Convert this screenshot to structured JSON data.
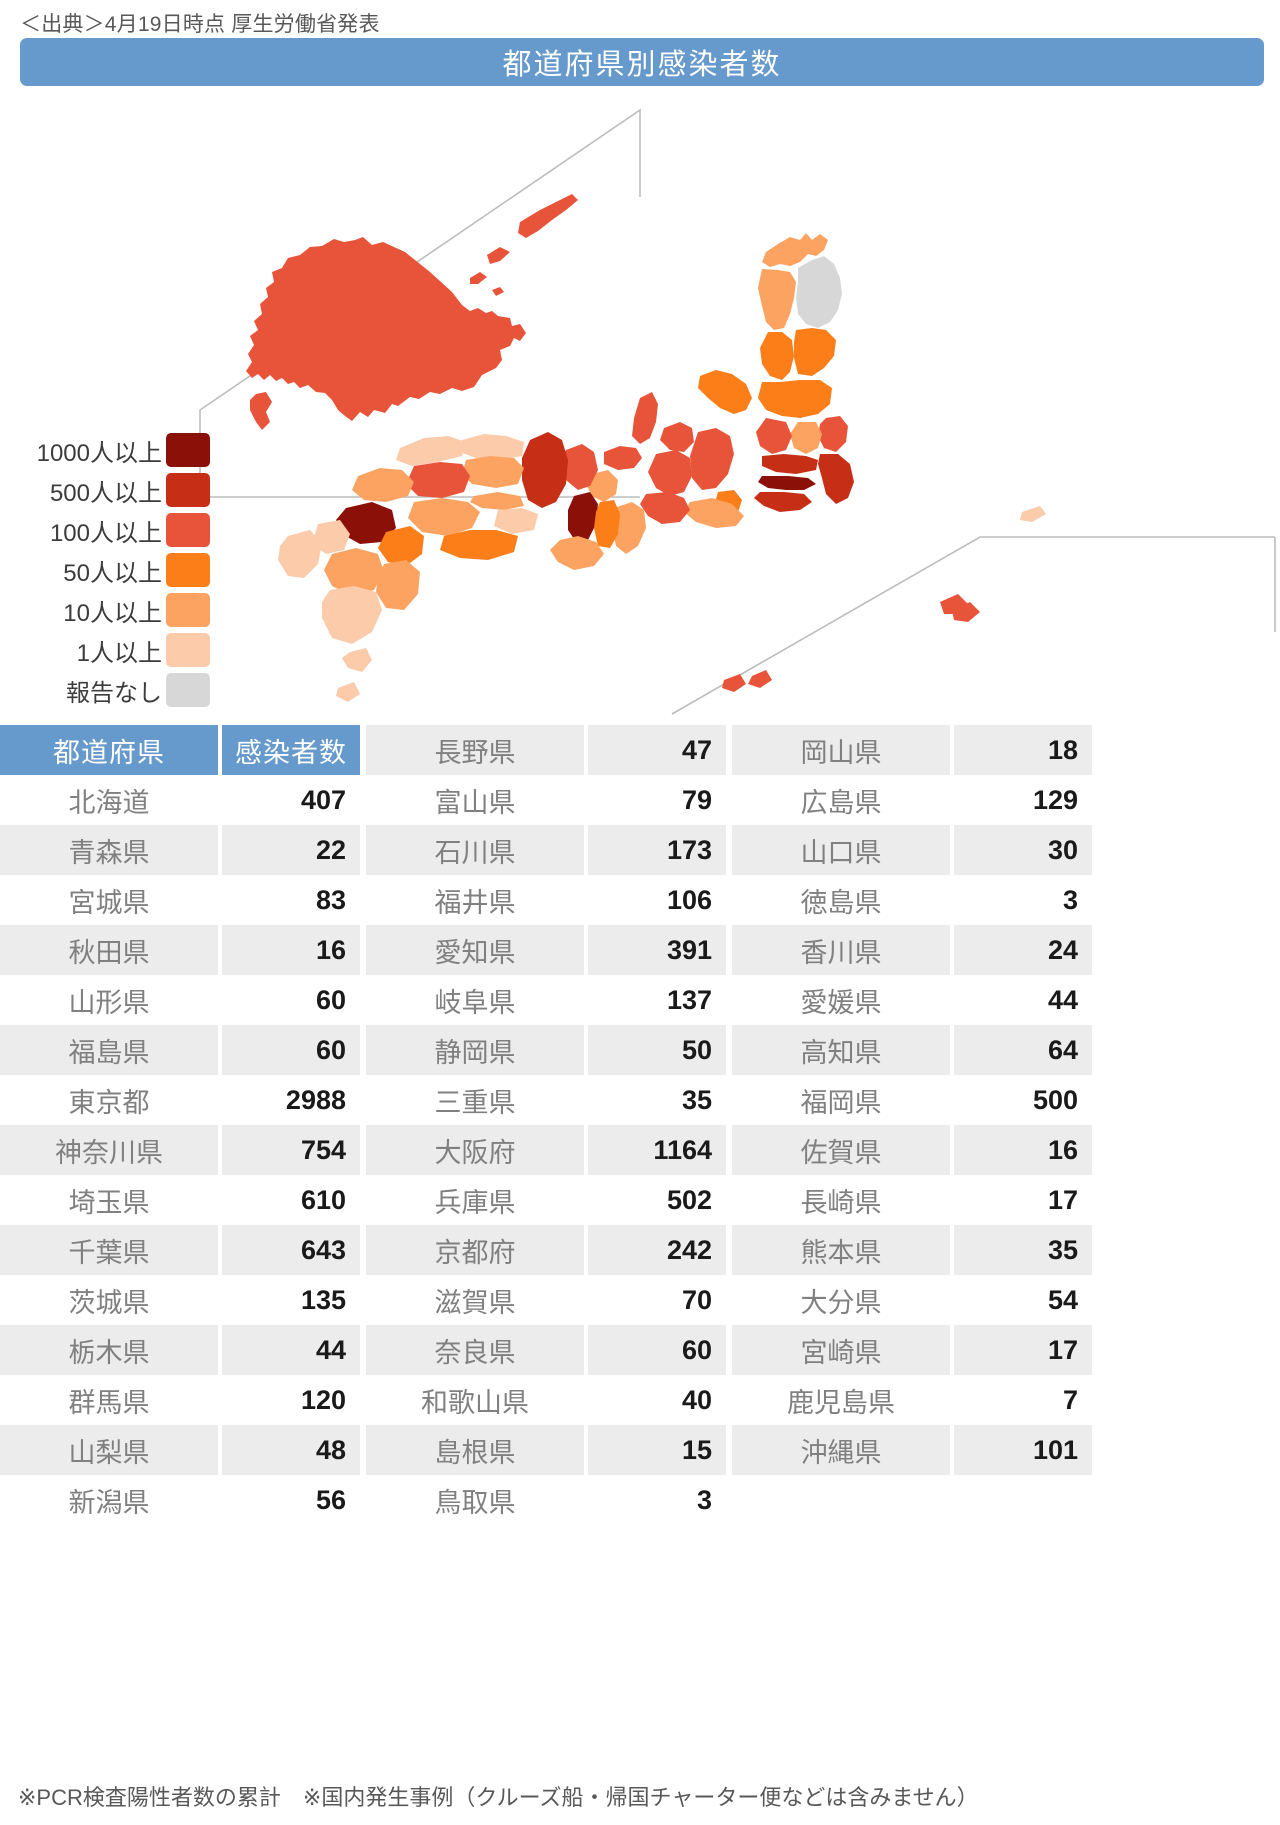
{
  "source": "＜出典＞4月19日時点 厚生労働省発表",
  "title": "都道府県別感染者数",
  "footnote": "※PCR検査陽性者数の累計　※国内発生事例（クルーズ船・帰国チャーター便などは含みません）",
  "legend": {
    "items": [
      {
        "label": "1000人以上",
        "color": "#8B1008"
      },
      {
        "label": "500人以上",
        "color": "#C62F16"
      },
      {
        "label": "100人以上",
        "color": "#E8543A"
      },
      {
        "label": "50人以上",
        "color": "#FB7E18"
      },
      {
        "label": "10人以上",
        "color": "#FCA361"
      },
      {
        "label": "1人以上",
        "color": "#FBCBAA"
      },
      {
        "label": "報告なし",
        "color": "#D7D7D7"
      }
    ]
  },
  "table": {
    "headers": {
      "prefecture": "都道府県",
      "count": "感染者数"
    },
    "columns": [
      [
        {
          "name": "北海道",
          "count": "407"
        },
        {
          "name": "青森県",
          "count": "22"
        },
        {
          "name": "宮城県",
          "count": "83"
        },
        {
          "name": "秋田県",
          "count": "16"
        },
        {
          "name": "山形県",
          "count": "60"
        },
        {
          "name": "福島県",
          "count": "60"
        },
        {
          "name": "東京都",
          "count": "2988"
        },
        {
          "name": "神奈川県",
          "count": "754"
        },
        {
          "name": "埼玉県",
          "count": "610"
        },
        {
          "name": "千葉県",
          "count": "643"
        },
        {
          "name": "茨城県",
          "count": "135"
        },
        {
          "name": "栃木県",
          "count": "44"
        },
        {
          "name": "群馬県",
          "count": "120"
        },
        {
          "name": "山梨県",
          "count": "48"
        },
        {
          "name": "新潟県",
          "count": "56"
        }
      ],
      [
        {
          "name": "長野県",
          "count": "47"
        },
        {
          "name": "富山県",
          "count": "79"
        },
        {
          "name": "石川県",
          "count": "173"
        },
        {
          "name": "福井県",
          "count": "106"
        },
        {
          "name": "愛知県",
          "count": "391"
        },
        {
          "name": "岐阜県",
          "count": "137"
        },
        {
          "name": "静岡県",
          "count": "50"
        },
        {
          "name": "三重県",
          "count": "35"
        },
        {
          "name": "大阪府",
          "count": "1164"
        },
        {
          "name": "兵庫県",
          "count": "502"
        },
        {
          "name": "京都府",
          "count": "242"
        },
        {
          "name": "滋賀県",
          "count": "70"
        },
        {
          "name": "奈良県",
          "count": "60"
        },
        {
          "name": "和歌山県",
          "count": "40"
        },
        {
          "name": "島根県",
          "count": "15"
        },
        {
          "name": "鳥取県",
          "count": "3"
        }
      ],
      [
        {
          "name": "岡山県",
          "count": "18"
        },
        {
          "name": "広島県",
          "count": "129"
        },
        {
          "name": "山口県",
          "count": "30"
        },
        {
          "name": "徳島県",
          "count": "3"
        },
        {
          "name": "香川県",
          "count": "24"
        },
        {
          "name": "愛媛県",
          "count": "44"
        },
        {
          "name": "高知県",
          "count": "64"
        },
        {
          "name": "福岡県",
          "count": "500"
        },
        {
          "name": "佐賀県",
          "count": "16"
        },
        {
          "name": "長崎県",
          "count": "17"
        },
        {
          "name": "熊本県",
          "count": "35"
        },
        {
          "name": "大分県",
          "count": "54"
        },
        {
          "name": "宮崎県",
          "count": "17"
        },
        {
          "name": "鹿児島県",
          "count": "7"
        },
        {
          "name": "沖縄県",
          "count": "101"
        }
      ]
    ]
  },
  "map": {
    "banner_color": "#6699cc",
    "inset_line_color": "#bdbdbd",
    "regions": [
      {
        "id": "hokkaido",
        "fill": "#E8543A"
      },
      {
        "id": "aomori",
        "fill": "#FCA361"
      },
      {
        "id": "akita",
        "fill": "#FCA361"
      },
      {
        "id": "iwate",
        "fill": "#D7D7D7"
      },
      {
        "id": "yamagata",
        "fill": "#FB7E18"
      },
      {
        "id": "miyagi",
        "fill": "#FB7E18"
      },
      {
        "id": "fukushima",
        "fill": "#FB7E18"
      },
      {
        "id": "tokyo",
        "fill": "#8B1008"
      },
      {
        "id": "kanagawa",
        "fill": "#C62F16"
      },
      {
        "id": "saitama",
        "fill": "#C62F16"
      },
      {
        "id": "chiba",
        "fill": "#C62F16"
      },
      {
        "id": "osaka",
        "fill": "#8B1008"
      },
      {
        "id": "hyogo",
        "fill": "#C62F16"
      },
      {
        "id": "kyoto",
        "fill": "#E8543A"
      },
      {
        "id": "aichi",
        "fill": "#E8543A"
      },
      {
        "id": "fukuoka",
        "fill": "#8B1008"
      },
      {
        "id": "okinawa",
        "fill": "#E8543A"
      }
    ]
  }
}
